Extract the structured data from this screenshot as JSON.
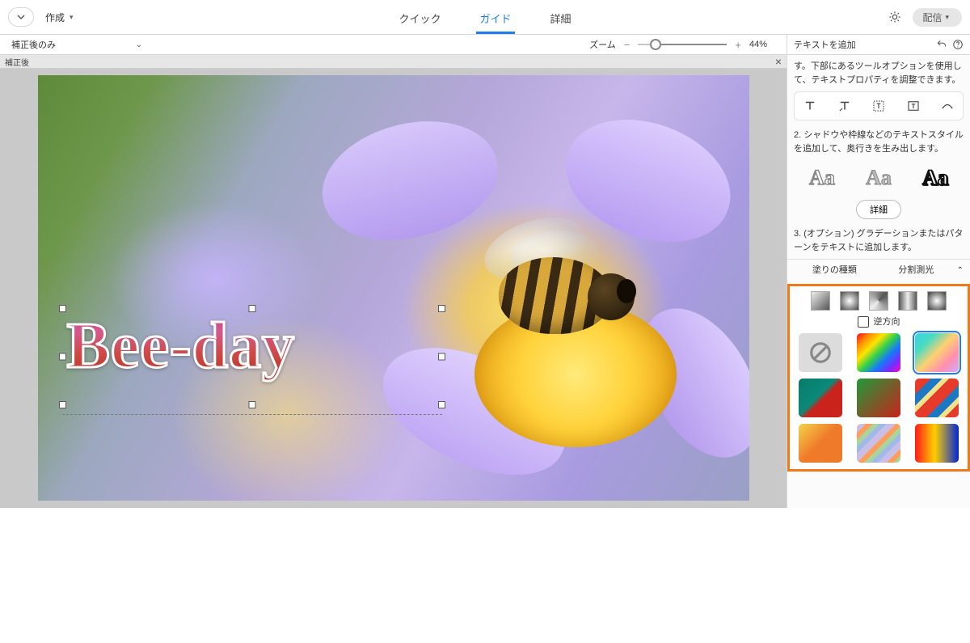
{
  "topbar": {
    "create_label": "作成",
    "modes": {
      "quick": "クイック",
      "guide": "ガイド",
      "detail": "詳細"
    },
    "share_label": "配信"
  },
  "subbar": {
    "view_label": "補正後のみ",
    "zoom_label": "ズーム",
    "zoom_value": "44%"
  },
  "canvas": {
    "tab_label": "補正後",
    "text_content": "Bee-day"
  },
  "panel": {
    "title": "テキストを追加",
    "step1_text": "す。下部にあるツールオプションを使用して、テキストプロパティを調整できます。",
    "step2_text": "2. シャドウや枠線などのテキストスタイルを追加して、奥行きを生み出します。",
    "aa_sample": "Aa",
    "detail_btn": "詳細",
    "step3_text": "3. (オプション) グラデーションまたはパターンをテキストに追加します。",
    "accordion": {
      "fill_type": "塗りの種類",
      "split_metering": "分割測光"
    },
    "reverse_label": "逆方向"
  }
}
